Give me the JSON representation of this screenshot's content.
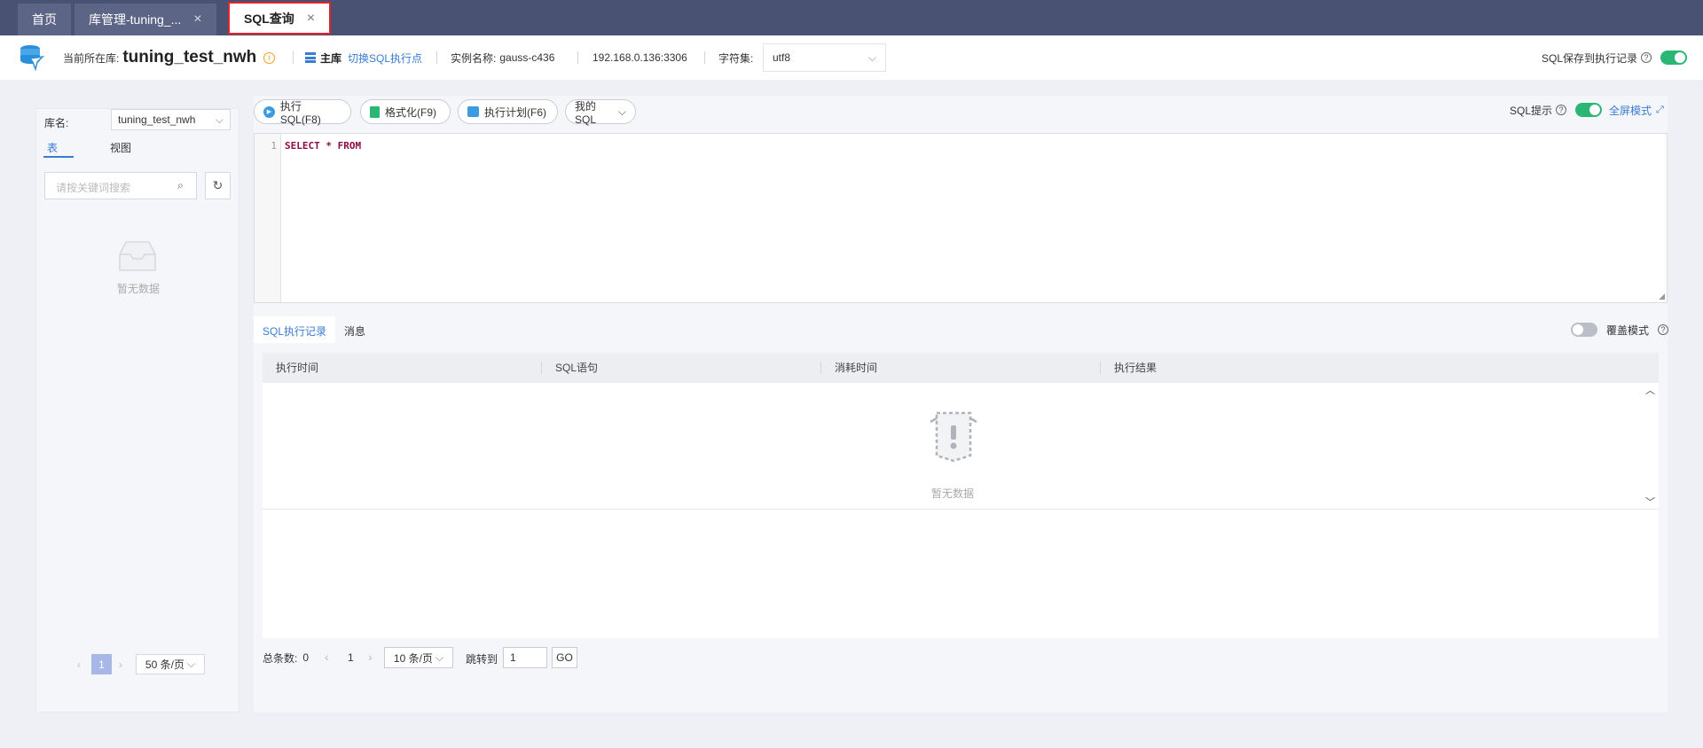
{
  "tabs": [
    {
      "label": "首页",
      "active": false,
      "closable": false
    },
    {
      "label": "库管理-tuning_...",
      "active": false,
      "closable": true
    },
    {
      "label": "SQL查询",
      "active": true,
      "closable": true
    }
  ],
  "header": {
    "current_db_label": "当前所在库:",
    "current_db": "tuning_test_nwh",
    "role": "主库",
    "switch_link": "切换SQL执行点",
    "instance_label": "实例名称:",
    "instance_name": "gauss-c436",
    "address": "192.168.0.136:3306",
    "charset_label": "字符集:",
    "charset_value": "utf8",
    "save_history_label": "SQL保存到执行记录",
    "save_history_on": true
  },
  "left": {
    "db_label": "库名:",
    "db_select": "tuning_test_nwh",
    "tabs": [
      "表",
      "视图"
    ],
    "active_tab": 0,
    "search_placeholder": "请按关键词搜索",
    "empty_text": "暂无数据",
    "pagination": {
      "current": "1",
      "page_size": "50 条/页"
    }
  },
  "toolbar": {
    "execute": "执行SQL(F8)",
    "format": "格式化(F9)",
    "plan": "执行计划(F6)",
    "my_sql": "我的SQL",
    "sql_hint_label": "SQL提示",
    "sql_hint_on": true,
    "fullscreen": "全屏模式"
  },
  "editor": {
    "line_number": "1",
    "code": "SELECT * FROM"
  },
  "results": {
    "tabs": [
      "SQL执行记录",
      "消息"
    ],
    "active_tab": 0,
    "overwrite_label": "覆盖模式",
    "overwrite_on": false,
    "columns": [
      "执行时间",
      "SQL语句",
      "消耗时间",
      "执行结果"
    ],
    "rows": [],
    "empty_text": "暂无数据",
    "pagination": {
      "total_label": "总条数:",
      "total": "0",
      "current": "1",
      "page_size": "10 条/页",
      "jump_label": "跳转到",
      "jump_value": "1",
      "go": "GO"
    }
  },
  "colors": {
    "tabbar": "#4a5274",
    "accent_blue": "#3a7bd5",
    "toggle_green": "#2bb673",
    "active_tab_border": "#e0242c"
  }
}
